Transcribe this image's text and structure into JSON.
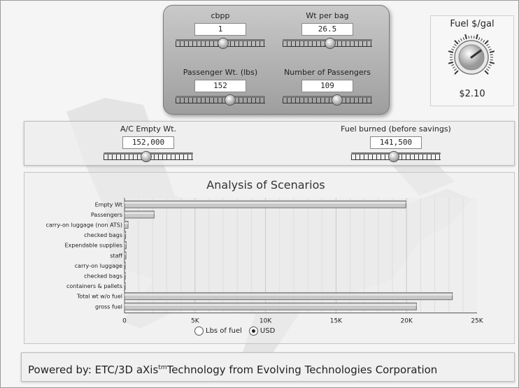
{
  "controls": {
    "cbpp": {
      "label": "cbpp",
      "value": "1",
      "position": 0.52
    },
    "wt_per_bag": {
      "label": "Wt per bag",
      "value": "26.5",
      "position": 0.52
    },
    "passenger_wt": {
      "label": "Passenger Wt. (lbs)",
      "value": "152",
      "position": 0.6
    },
    "num_passengers": {
      "label": "Number of Passengers",
      "value": "109",
      "position": 0.6
    },
    "ac_empty_wt": {
      "label": "A/C Empty Wt.",
      "value": "152,000",
      "position": 0.47
    },
    "fuel_burned": {
      "label": "Fuel burned (before savings)",
      "value": "141,500",
      "position": 0.47
    }
  },
  "fuel": {
    "title": "Fuel $/gal",
    "value": "$2.10",
    "level": 0.7,
    "knob_icon": "dial-knob-icon"
  },
  "chart_data": {
    "type": "bar",
    "title": "Analysis of Scenarios",
    "categories": [
      "Empty Wt",
      "Passengers",
      "carry-on luggage (non ATS)",
      "checked bags",
      "Expendable supplies",
      "staff",
      "carry-on luggage",
      "checked bags",
      "containers & pallets",
      "Total wt w/o fuel",
      "gross fuel"
    ],
    "values": [
      19950,
      2100,
      250,
      80,
      120,
      100,
      20,
      40,
      20,
      23250,
      20700
    ],
    "xlim": [
      0,
      25000
    ],
    "xticks": [
      "0",
      "5K",
      "10K",
      "15K",
      "20K",
      "25K"
    ],
    "grid": true,
    "orientation": "horizontal"
  },
  "radios": [
    {
      "label": "Lbs of fuel",
      "selected": false
    },
    {
      "label": "USD",
      "selected": true
    }
  ],
  "footer": {
    "prefix": "Powered by: ETC/3D aXis",
    "sup": "tm",
    "suffix": "Technology from Evolving Technologies Corporation"
  },
  "colors": {
    "bar": "#c9c9c9",
    "bar_edge": "#6e6e6e",
    "panel": "#b5b5b5"
  }
}
